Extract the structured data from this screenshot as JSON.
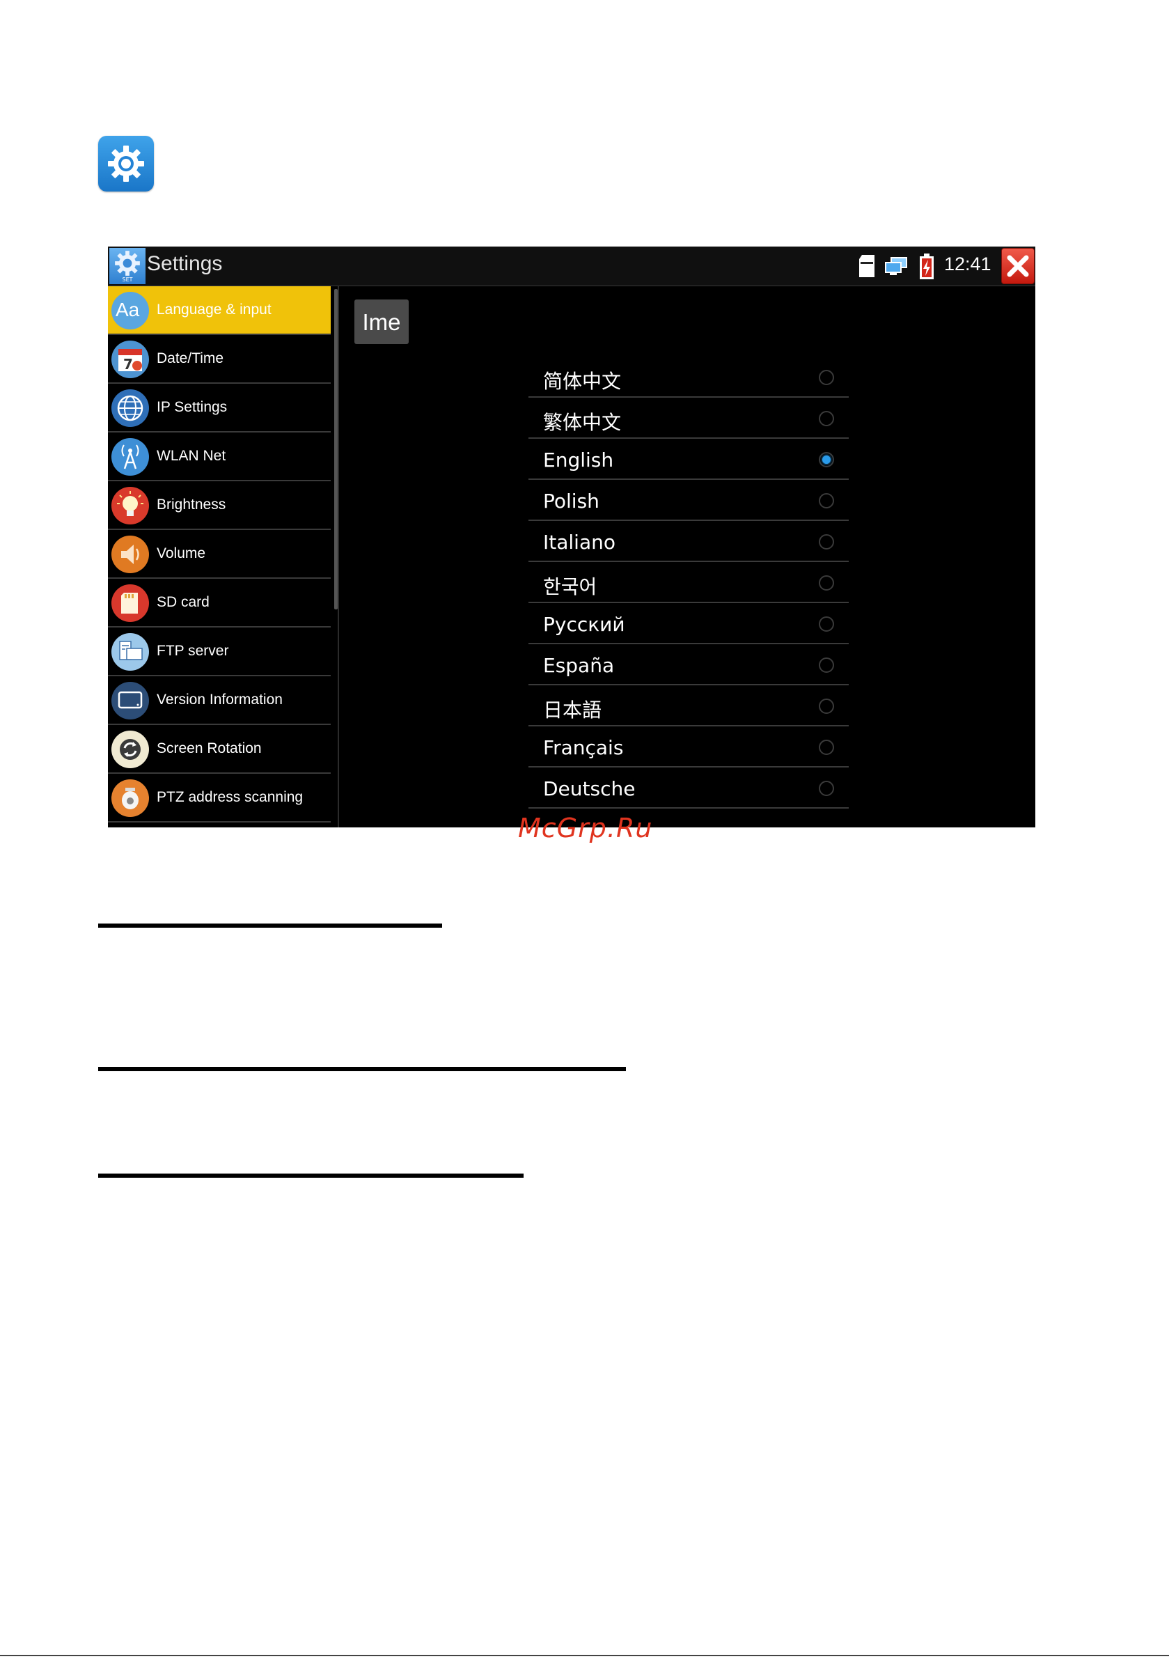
{
  "header": {
    "title": "Settings",
    "icon_caption": "SET",
    "time": "12:41"
  },
  "sidebar": {
    "items": [
      {
        "label": "Language & input",
        "icon": "language-icon",
        "active": true
      },
      {
        "label": "Date/Time",
        "icon": "calendar-icon"
      },
      {
        "label": "IP Settings",
        "icon": "globe-icon"
      },
      {
        "label": "WLAN Net",
        "icon": "antenna-icon"
      },
      {
        "label": "Brightness",
        "icon": "bulb-icon"
      },
      {
        "label": "Volume",
        "icon": "speaker-icon"
      },
      {
        "label": "SD card",
        "icon": "sd-card-icon"
      },
      {
        "label": "FTP server",
        "icon": "ftp-icon"
      },
      {
        "label": "Version Information",
        "icon": "monitor-icon"
      },
      {
        "label": "Screen Rotation",
        "icon": "rotate-icon"
      },
      {
        "label": "PTZ address scanning",
        "icon": "ptz-camera-icon"
      }
    ]
  },
  "main": {
    "ime_button": "Ime",
    "languages": [
      {
        "label": "简体中文",
        "selected": false
      },
      {
        "label": "繁体中文",
        "selected": false
      },
      {
        "label": "English",
        "selected": true
      },
      {
        "label": "Polish",
        "selected": false
      },
      {
        "label": "Italiano",
        "selected": false
      },
      {
        "label": "한국어",
        "selected": false
      },
      {
        "label": "Русский",
        "selected": false
      },
      {
        "label": "España",
        "selected": false
      },
      {
        "label": "日本語",
        "selected": false
      },
      {
        "label": "Français",
        "selected": false
      },
      {
        "label": "Deutsche",
        "selected": false
      }
    ]
  },
  "watermark": "McGrp.Ru",
  "colors": {
    "active_item": "#f0c20a",
    "radio_checked": "#2a9bea",
    "close_button": "#d9261a"
  }
}
